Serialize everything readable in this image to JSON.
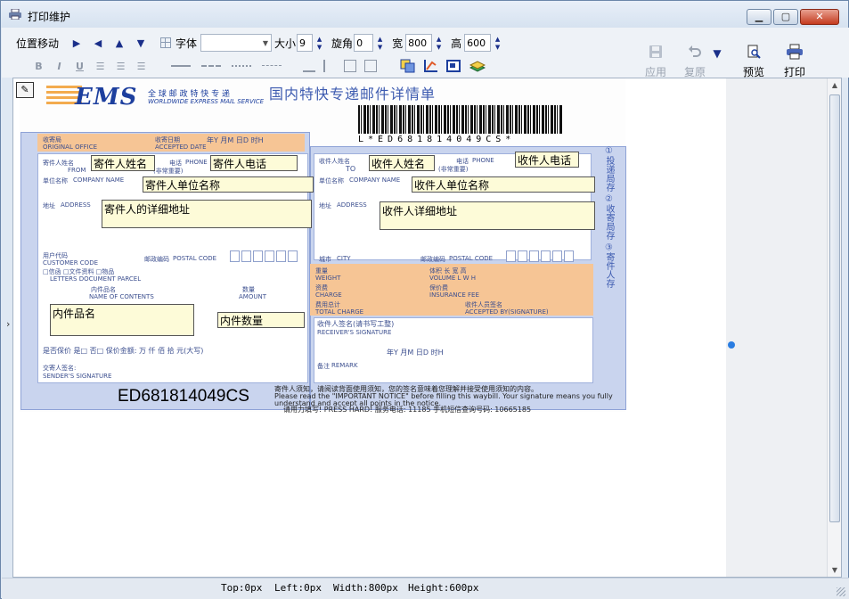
{
  "window": {
    "title": "打印维护"
  },
  "toolbar": {
    "position_label": "位置移动",
    "font_label": "字体",
    "font_value": "",
    "size_label": "大小",
    "size_value": "9",
    "rotate_label": "旋角",
    "rotate_value": "0",
    "width_label": "宽",
    "width_value": "800",
    "height_label": "高",
    "height_value": "600",
    "format_bold": "B",
    "format_italic": "I",
    "format_underline": "U",
    "apply_label": "应用",
    "restore_label": "复原",
    "preview_label": "预览",
    "print_label": "打印"
  },
  "waybill": {
    "logo": "EMS",
    "logo_sub": "全 球 邮 政 特 快 专 递",
    "logo_sub_en": "WORLDWIDE EXPRESS MAIL SERVICE",
    "form_title": "国内特快专递邮件详情单",
    "barcode_text": "L*ED681814049CS*",
    "labels": {
      "origin_office": "收寄局",
      "origin_office_en": "ORIGINAL OFFICE",
      "accepted_date": "收寄日期",
      "accepted_date_en": "ACCEPTED DATE",
      "date_fields": "年Y  月M  日D  时H",
      "sender_name": "寄件人姓名",
      "sender_name_en": "FROM",
      "phone": "电话",
      "phone_en": "PHONE",
      "important": "(非常重要)",
      "company": "单位名称",
      "company_en": "COMPANY NAME",
      "address": "地址",
      "address_en": "ADDRESS",
      "customer_code": "用户代码",
      "customer_code_en": "CUSTOMER CODE",
      "postal_code": "邮政编码",
      "postal_code_en": "POSTAL CODE",
      "recipient_name": "收件人姓名",
      "recipient_name_en": "TO",
      "city": "城市",
      "city_en": "CITY",
      "weight": "重量",
      "weight_en": "WEIGHT",
      "volume": "体积  长  宽  高",
      "volume_en": "VOLUME  L  W  H",
      "charge": "资费",
      "charge_en": "CHARGE",
      "insurance_fee": "保价费",
      "insurance_fee_en": "INSURANCE FEE",
      "total_charge": "费用总计",
      "total_charge_en": "TOTAL CHARGE",
      "accepted_by": "收件人员签名",
      "accepted_by_en": "ACCEPTED BY(SIGNATURE)",
      "contents_type": "□信函  □文件资料  □物品",
      "contents_type_en": "LETTERS  DOCUMENT  PARCEL",
      "contents_name": "内件品名",
      "contents_name_en": "NAME OF CONTENTS",
      "amount": "数量",
      "amount_en": "AMOUNT",
      "receiver_signature": "收件人签名(请书写工整)",
      "receiver_signature_en": "RECEIVER'S SIGNATURE",
      "insured": "是否保价  是□  否□  保价金额:  万  仟  佰  拾  元(大写)",
      "sender_signature": "交寄人签名:",
      "sender_signature_en": "SENDER'S SIGNATURE",
      "remark": "备注",
      "remark_en": "REMARK",
      "sign_date": "年Y  月M  日D  时H",
      "side_text": "①投递局存 ②收寄局存 ③寄件人存",
      "notice_1": "寄件人须知，请阅读背面使用须知，您的签名意味着您理解并接受使用须知的内容。",
      "notice_2": "Please read the \"IMPORTANT NOTICE\" before filling this waybill. Your signature means you fully",
      "notice_3": "understand and accept all points in the notice.",
      "notice_4": "请用力填写!  PRESS HARD!   服务电话: 11185   手机短信查询号码: 10665185"
    },
    "fields": {
      "sender_name": "寄件人姓名",
      "sender_phone": "寄件人电话",
      "sender_company": "寄件人单位名称",
      "sender_address": "寄件人的详细地址",
      "recipient_name": "收件人姓名",
      "recipient_phone": "收件人电话",
      "recipient_company": "收件人单位名称",
      "recipient_address": "收件人详细地址",
      "contents_name": "内件品名",
      "contents_amount": "内件数量"
    },
    "tracking_number": "ED681814049CS"
  },
  "statusbar": {
    "top": "Top:0px",
    "left": "Left:0px",
    "width": "Width:800px",
    "height": "Height:600px"
  },
  "colors": {
    "form_blue": "#c9d4ee",
    "form_orange": "#f6c595",
    "field_fill": "#fdfbd8",
    "ems_blue": "#1d3f9e"
  }
}
